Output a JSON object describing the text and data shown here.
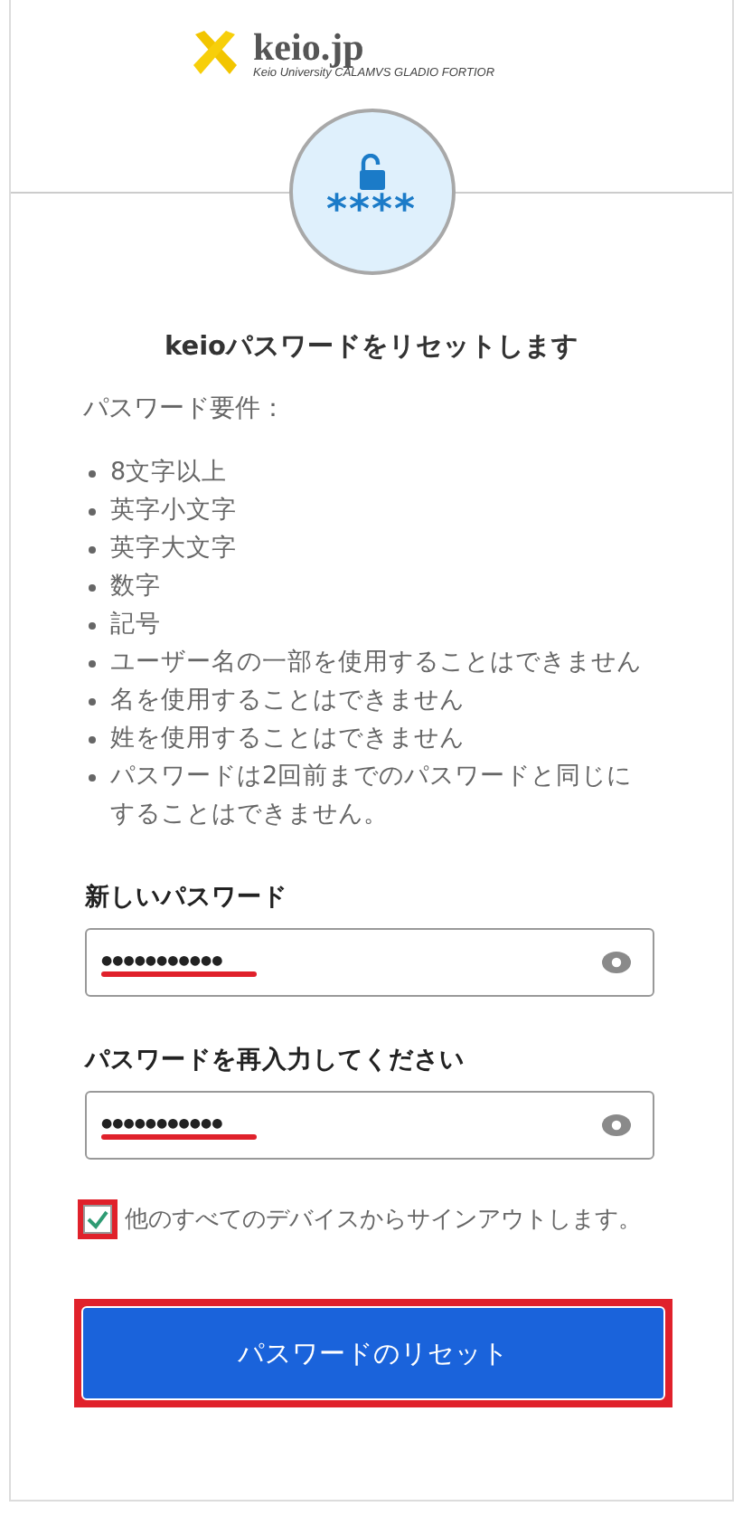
{
  "logo": {
    "name": "keio.jp",
    "tagline": "Keio University CALAMVS GLADIO FORTIOR"
  },
  "badge": {
    "text": "****"
  },
  "title": "keioパスワードをリセットします",
  "requirements": {
    "heading": "パスワード要件：",
    "items": [
      "8文字以上",
      "英字小文字",
      "英字大文字",
      "数字",
      "記号",
      "ユーザー名の一部を使用することはできません",
      "名を使用することはできません",
      "姓を使用することはできません",
      "パスワードは2回前までのパスワードと同じにすることはできません。"
    ]
  },
  "fields": [
    {
      "label": "新しいパスワード",
      "value": "●●●●●●●●●●●",
      "highlighted": true
    },
    {
      "label": "パスワードを再入力してください",
      "value": "●●●●●●●●●●●",
      "highlighted": true
    }
  ],
  "signout_checkbox": {
    "label": "他のすべてのデバイスからサインアウトします。",
    "checked": true,
    "highlighted": true
  },
  "submit_button": {
    "label": "パスワードのリセット",
    "highlighted": true
  }
}
